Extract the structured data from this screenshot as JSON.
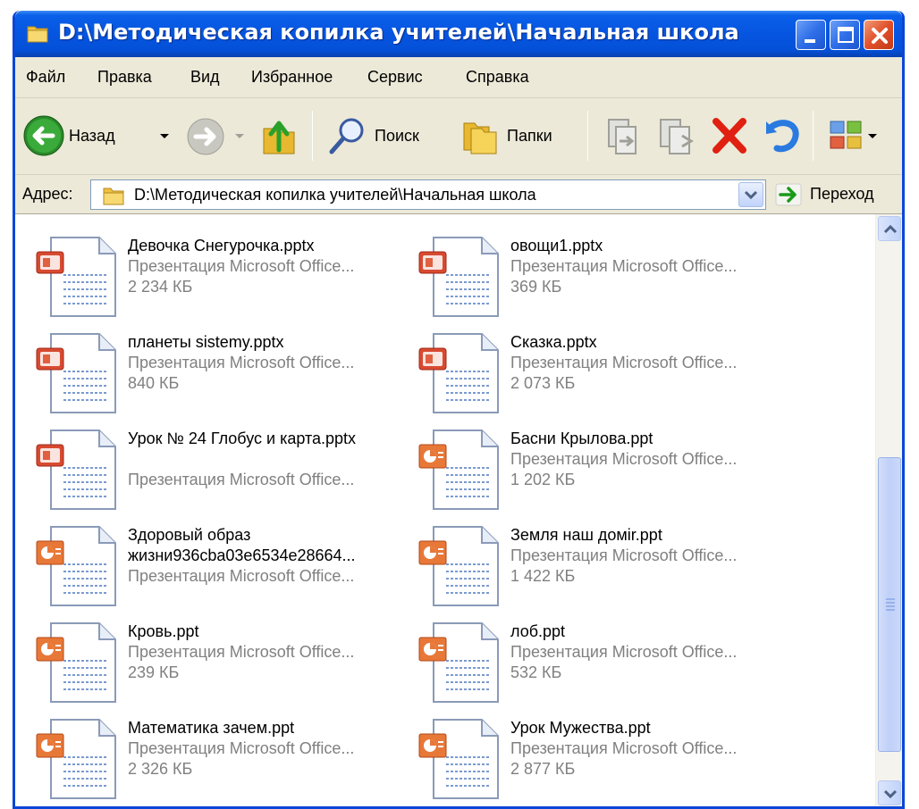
{
  "window": {
    "title": "D:\\Методическая копилка учителей\\Начальная школа"
  },
  "menu": [
    "Файл",
    "Правка",
    "Вид",
    "Избранное",
    "Сервис",
    "Справка"
  ],
  "toolbar": {
    "back_label": "Назад",
    "search_label": "Поиск",
    "folders_label": "Папки"
  },
  "address": {
    "label": "Адрес:",
    "value": "D:\\Методическая копилка учителей\\Начальная школа",
    "go_label": "Переход"
  },
  "files": [
    {
      "name": "Девочка Снегурочка.pptx",
      "type": "Презентация Microsoft Office...",
      "size": "2 234 КБ",
      "kind": "pptx"
    },
    {
      "name": "овощи1.pptx",
      "type": "Презентация Microsoft Office...",
      "size": "369 КБ",
      "kind": "pptx"
    },
    {
      "name": "планеты sistemy.pptx",
      "type": "Презентация Microsoft Office...",
      "size": "840 КБ",
      "kind": "pptx"
    },
    {
      "name": "Сказка.pptx",
      "type": "Презентация Microsoft Office...",
      "size": "2 073 КБ",
      "kind": "pptx"
    },
    {
      "name": "Урок № 24 Глобус и карта.pptx",
      "type": "Презентация Microsoft Office...",
      "size": "",
      "kind": "pptx"
    },
    {
      "name": "Басни Крылова.ppt",
      "type": "Презентация Microsoft Office...",
      "size": "1 202 КБ",
      "kind": "ppt"
    },
    {
      "name": "Здоровый образ жизни936cba03e6534e28664...",
      "type": "Презентация Microsoft Office...",
      "size": "",
      "kind": "ppt"
    },
    {
      "name": "Земля наш домir.ppt",
      "type": "Презентация Microsoft Office...",
      "size": "1 422 КБ",
      "kind": "ppt"
    },
    {
      "name": "Кровь.ppt",
      "type": "Презентация Microsoft Office...",
      "size": "239 КБ",
      "kind": "ppt"
    },
    {
      "name": "лоб.ppt",
      "type": "Презентация Microsoft Office...",
      "size": "532 КБ",
      "kind": "ppt"
    },
    {
      "name": "Математика зачем.ppt",
      "type": "Презентация Microsoft Office...",
      "size": "2 326 КБ",
      "kind": "ppt"
    },
    {
      "name": "Урок Мужества.ppt",
      "type": "Презентация Microsoft Office...",
      "size": "2 877 КБ",
      "kind": "ppt"
    }
  ],
  "colors": {
    "titlebar": "#0655e0",
    "window_bg": "#ece9d8",
    "close_button": "#e0502a",
    "delete_icon": "#e02010",
    "muted_text": "#808080"
  }
}
